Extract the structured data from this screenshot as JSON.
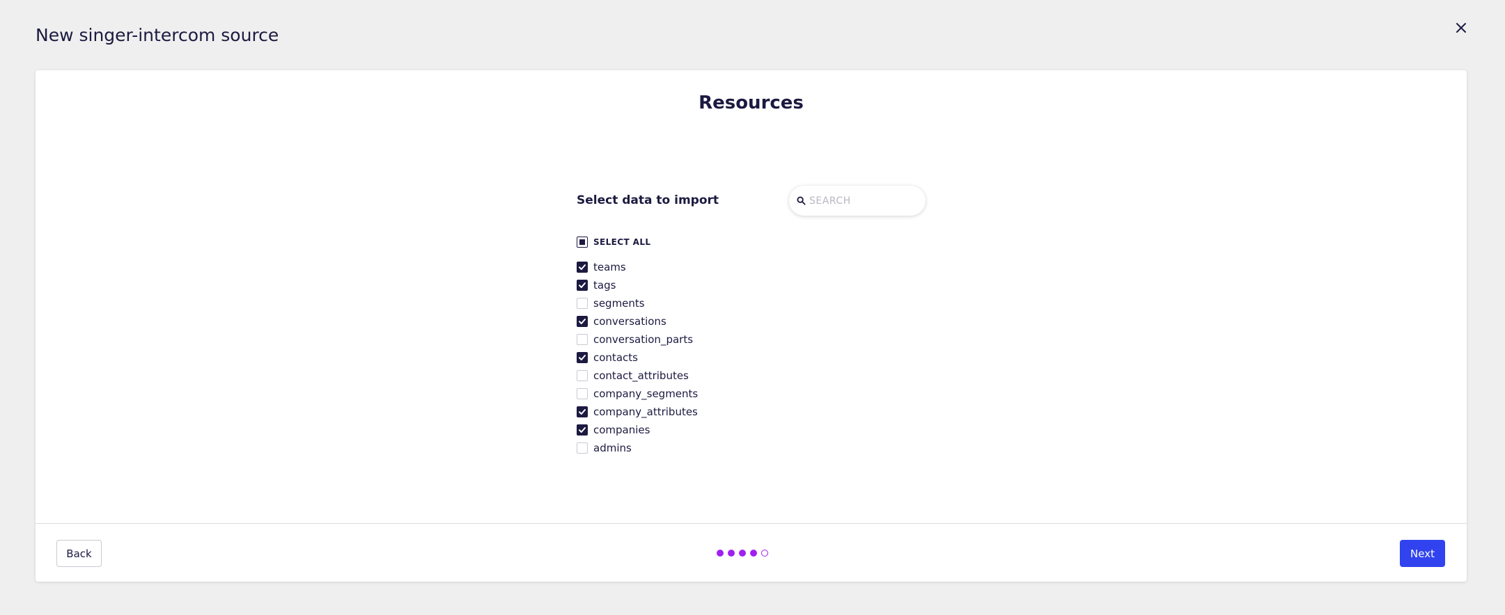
{
  "header": {
    "title": "New singer-intercom source"
  },
  "card": {
    "title": "Resources",
    "section_label": "Select data to import",
    "search": {
      "placeholder": "SEARCH",
      "value": ""
    },
    "select_all": {
      "label": "SELECT ALL",
      "state": "indeterminate"
    },
    "items": [
      {
        "label": "teams",
        "checked": true
      },
      {
        "label": "tags",
        "checked": true
      },
      {
        "label": "segments",
        "checked": false
      },
      {
        "label": "conversations",
        "checked": true
      },
      {
        "label": "conversation_parts",
        "checked": false
      },
      {
        "label": "contacts",
        "checked": true
      },
      {
        "label": "contact_attributes",
        "checked": false
      },
      {
        "label": "company_segments",
        "checked": false
      },
      {
        "label": "company_attributes",
        "checked": true
      },
      {
        "label": "companies",
        "checked": true
      },
      {
        "label": "admins",
        "checked": false
      }
    ]
  },
  "footer": {
    "back_label": "Back",
    "next_label": "Next",
    "steps": [
      "done",
      "done",
      "done",
      "done",
      "current"
    ]
  },
  "colors": {
    "primary": "#3043ee",
    "text": "#1c1a40",
    "step_accent": "#a020f0",
    "background": "#efefef"
  },
  "icons": {
    "close": "close-icon",
    "search": "search-icon",
    "check": "check-icon"
  }
}
